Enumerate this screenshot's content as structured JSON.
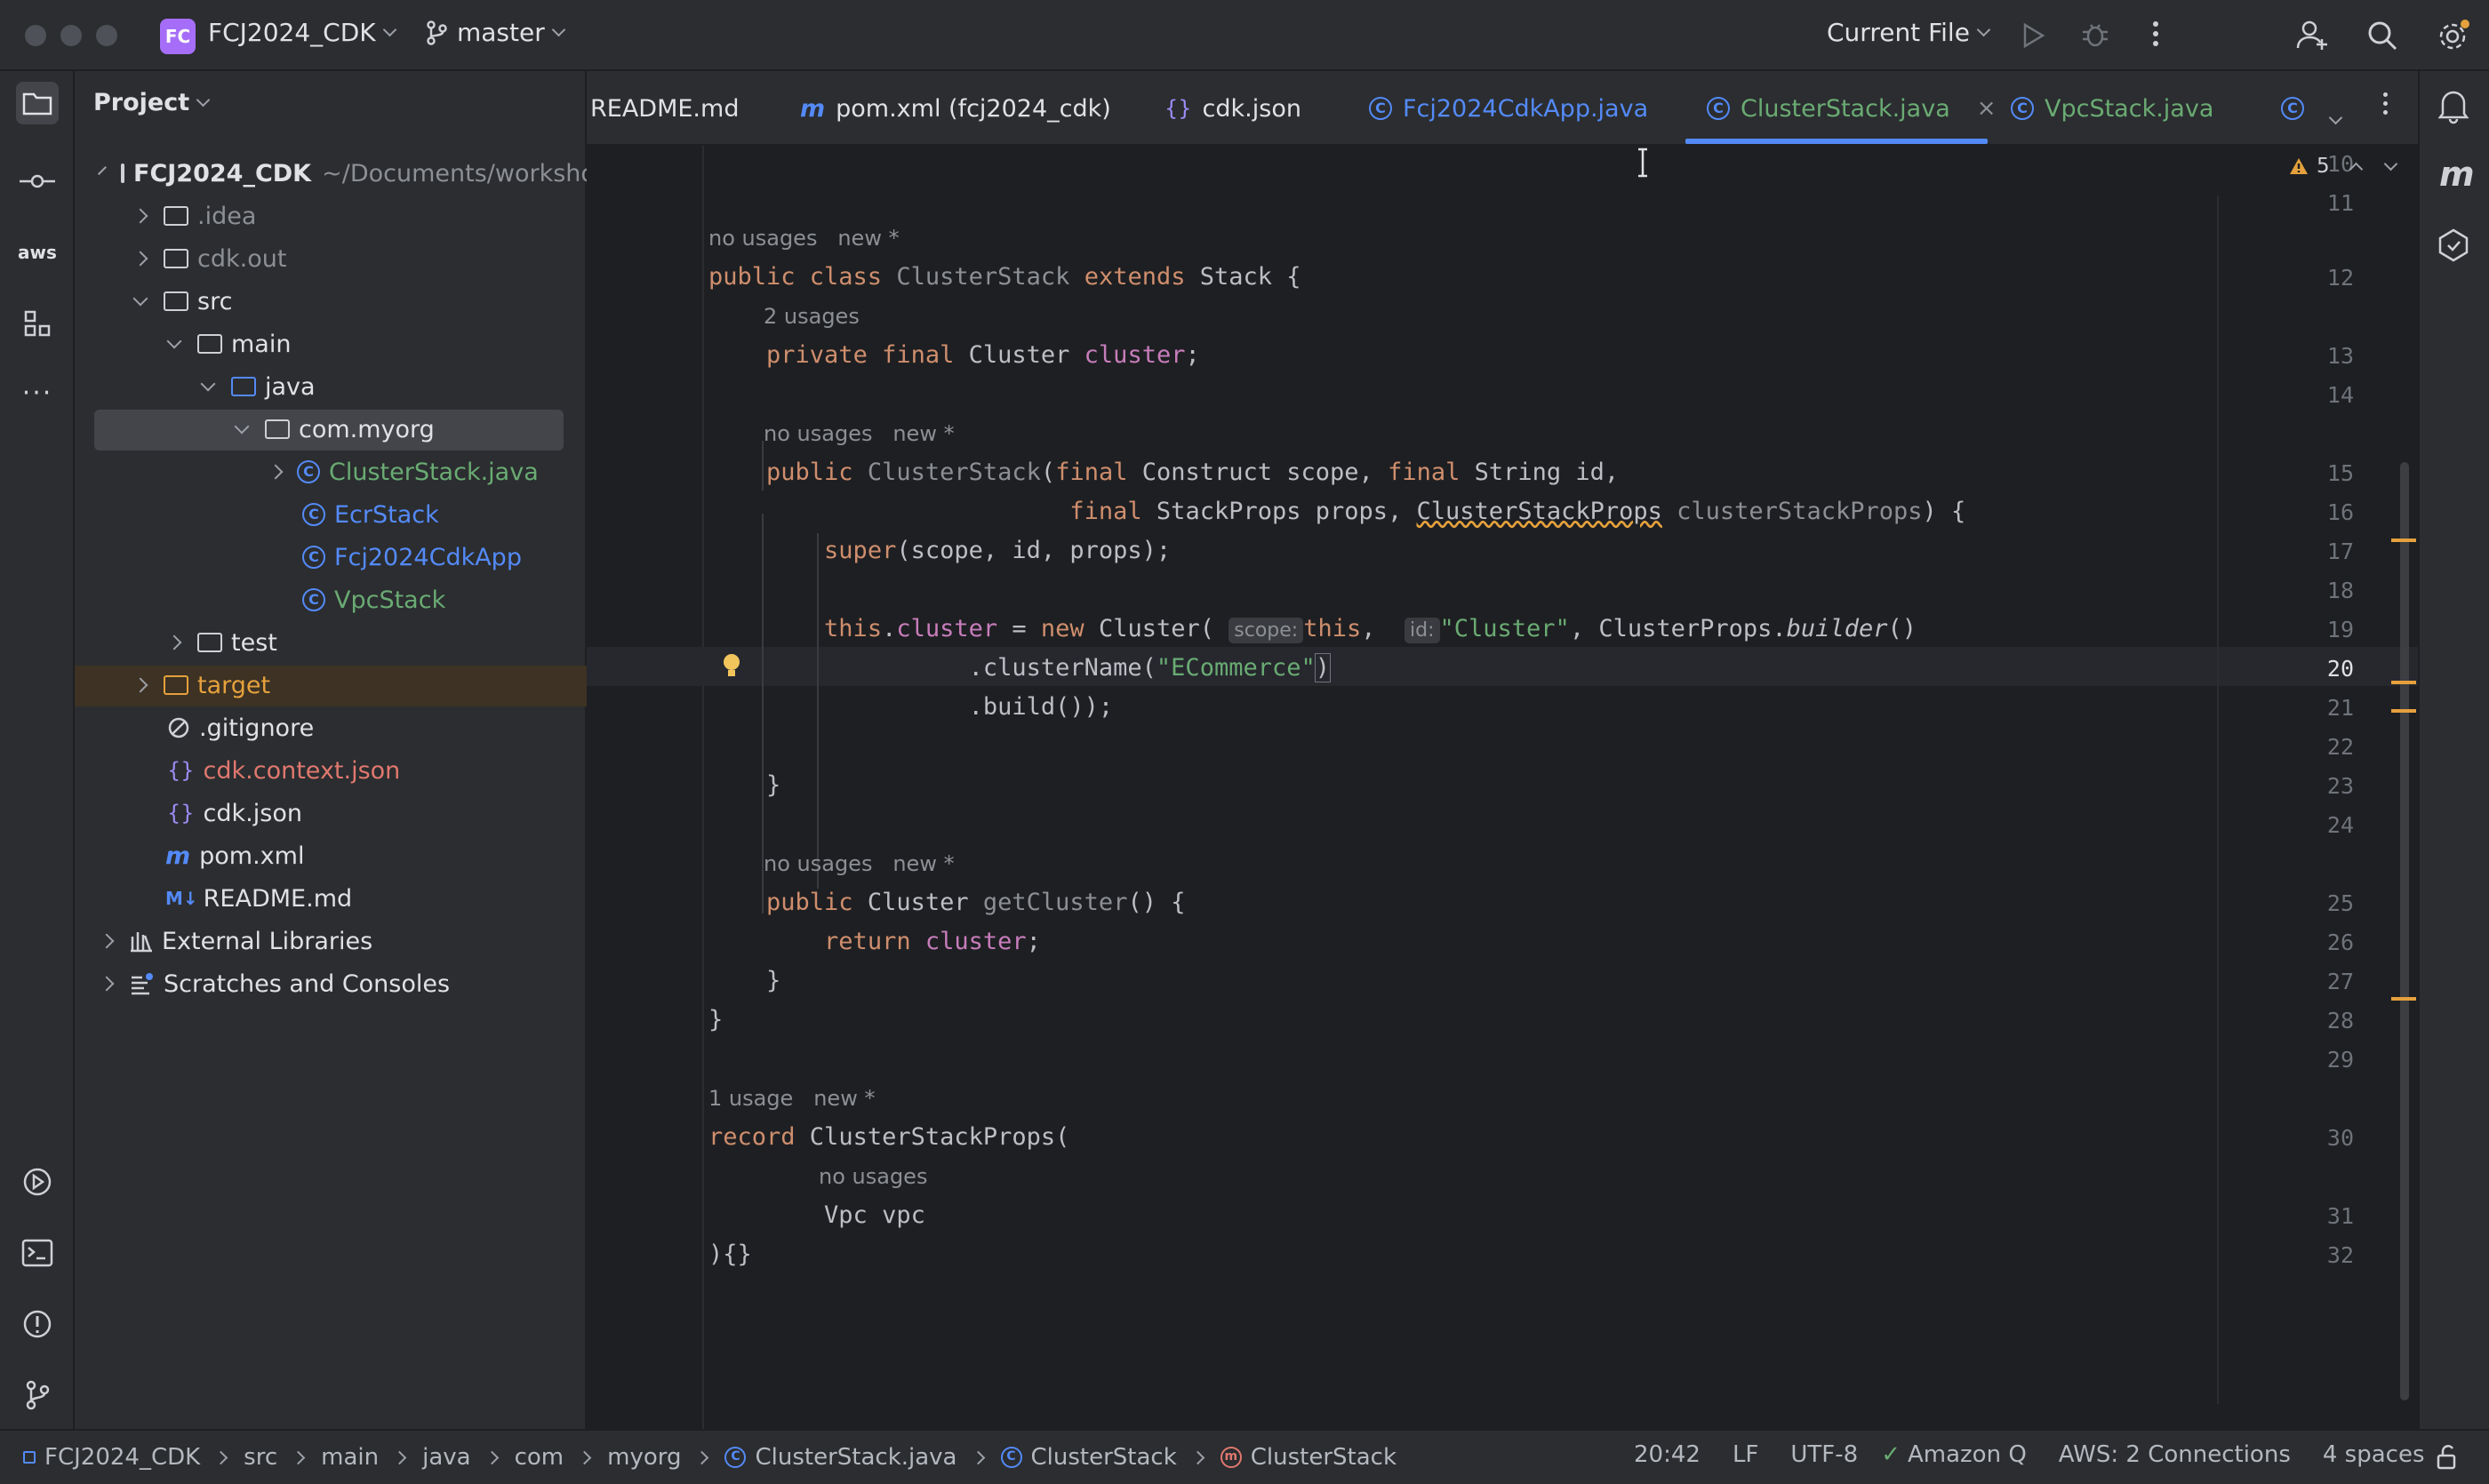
{
  "titlebar": {
    "project_initials": "FC",
    "project_name": "FCJ2024_CDK",
    "branch": "master",
    "run_config": "Current File"
  },
  "project_panel": {
    "title": "Project",
    "root_name": "FCJ2024_CDK",
    "root_path": "~/Documents/workshop",
    "tree": {
      "idea": ".idea",
      "cdk_out": "cdk.out",
      "src": "src",
      "main": "main",
      "java": "java",
      "package": "com.myorg",
      "cluster_stack": "ClusterStack.java",
      "ecr_stack": "EcrStack",
      "app": "Fcj2024CdkApp",
      "vpc_stack": "VpcStack",
      "test": "test",
      "target": "target",
      "gitignore": ".gitignore",
      "cdk_context": "cdk.context.json",
      "cdk_json": "cdk.json",
      "pom": "pom.xml",
      "readme": "README.md",
      "external_libraries": "External Libraries",
      "scratches": "Scratches and Consoles"
    }
  },
  "tabs": [
    {
      "label": "README.md"
    },
    {
      "label": "pom.xml (fcj2024_cdk)"
    },
    {
      "label": "cdk.json"
    },
    {
      "label": "Fcj2024CdkApp.java"
    },
    {
      "label": "ClusterStack.java"
    },
    {
      "label": "VpcStack.java"
    }
  ],
  "editor": {
    "warnings_count": "5",
    "hints": {
      "no_usages": "no usages",
      "new": "new *",
      "two_usages": "2 usages",
      "one_usage": "1 usage"
    },
    "inlay": {
      "scope": "scope:",
      "id": "id:"
    },
    "line_numbers": [
      "10",
      "11",
      "12",
      "13",
      "14",
      "15",
      "16",
      "17",
      "18",
      "19",
      "20",
      "21",
      "22",
      "23",
      "24",
      "25",
      "26",
      "27",
      "28",
      "29",
      "30",
      "31",
      "32"
    ]
  },
  "statusbar": {
    "breadcrumbs": [
      "FCJ2024_CDK",
      "src",
      "main",
      "java",
      "com",
      "myorg",
      "ClusterStack.java",
      "ClusterStack",
      "ClusterStack"
    ],
    "position": "20:42",
    "line_sep": "LF",
    "encoding": "UTF-8",
    "amazon_q": "Amazon Q",
    "aws": "AWS: 2 Connections",
    "indent": "4 spaces"
  }
}
